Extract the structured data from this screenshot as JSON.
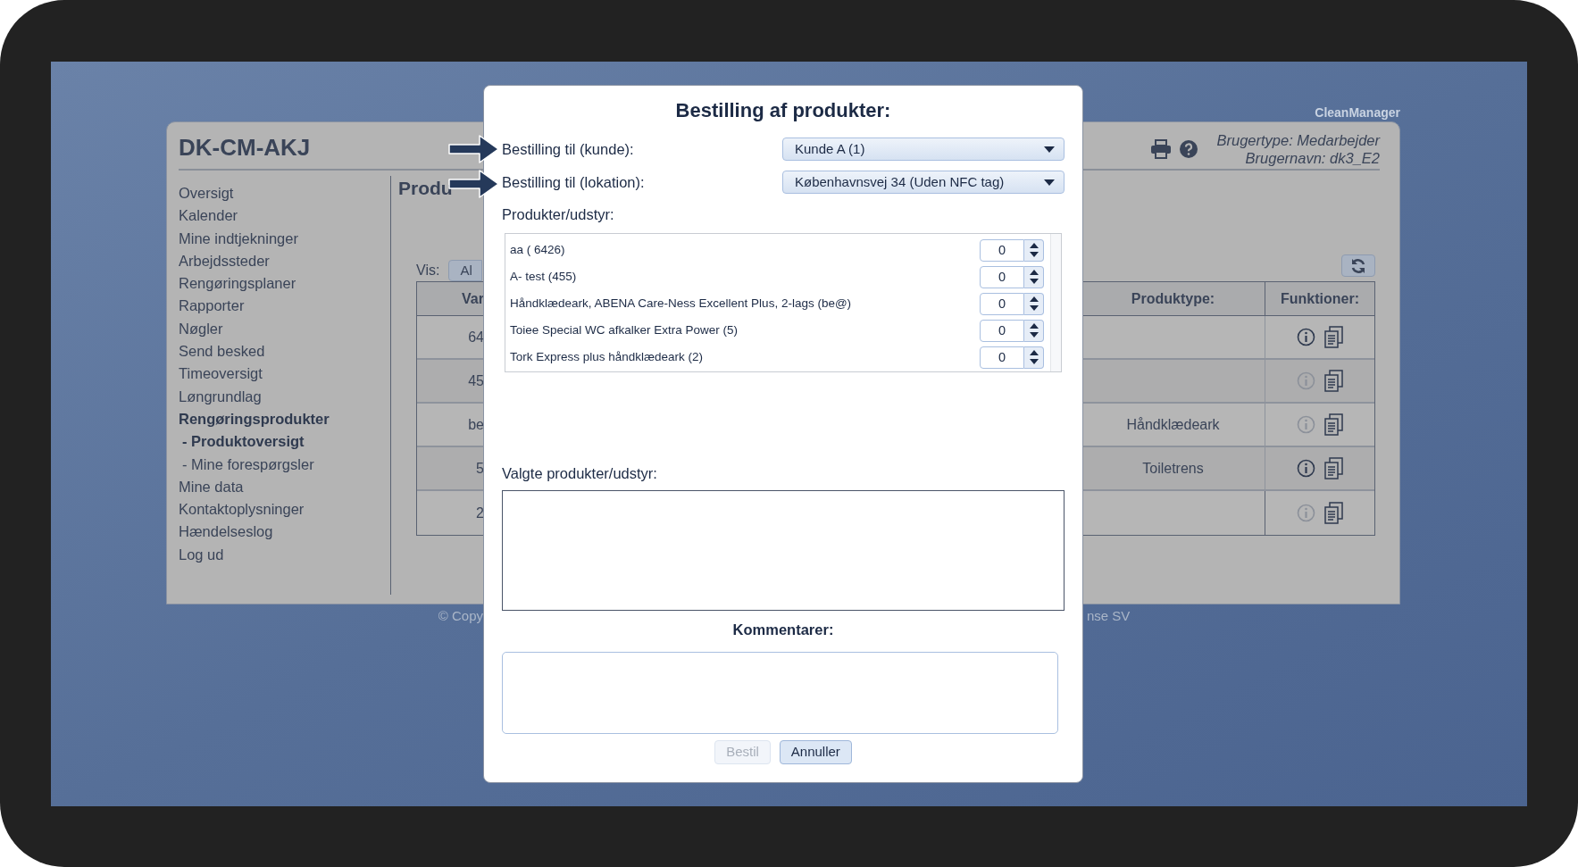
{
  "app": {
    "brand": "CleanManager",
    "site_title": "DK-CM-AKJ",
    "user_type": "Brugertype: Medarbejder",
    "user_name": "Brugernavn: dk3_E2"
  },
  "nav": [
    {
      "label": "Oversigt",
      "selected": false
    },
    {
      "label": "Kalender",
      "selected": false
    },
    {
      "label": "Mine indtjekninger",
      "selected": false
    },
    {
      "label": "Arbejdssteder",
      "selected": false
    },
    {
      "label": "Rengøringsplaner",
      "selected": false
    },
    {
      "label": "Rapporter",
      "selected": false
    },
    {
      "label": "Nøgler",
      "selected": false
    },
    {
      "label": "Send besked",
      "selected": false
    },
    {
      "label": "Timeoversigt",
      "selected": false
    },
    {
      "label": "Løngrundlag",
      "selected": false
    },
    {
      "label": "Rengøringsprodukter",
      "selected": true,
      "children": [
        {
          "label": "- Produktoversigt",
          "selected": true
        },
        {
          "label": "- Mine forespørgsler",
          "selected": false
        }
      ]
    },
    {
      "label": "Mine data",
      "selected": false
    },
    {
      "label": "Kontaktoplysninger",
      "selected": false
    },
    {
      "label": "Hændelseslog",
      "selected": false
    },
    {
      "label": "Log ud",
      "selected": false
    }
  ],
  "content": {
    "heading": "Produ",
    "filter_label": "Vis:",
    "filter_button": "Al"
  },
  "table": {
    "columns": [
      "Var",
      "Produktype:",
      "Funktioner:"
    ],
    "rows": [
      {
        "column_1": "64",
        "info_enabled": true
      },
      {
        "column_1": "45",
        "info_enabled": false
      },
      {
        "column_1": "be",
        "product_type": "Håndklædeark",
        "info_enabled": false
      },
      {
        "column_1": "5",
        "product_type": "Toiletrens",
        "info_enabled": true
      },
      {
        "column_1": "2",
        "info_enabled": false
      }
    ]
  },
  "footer": {
    "left": "© Copy",
    "right": "nse SV"
  },
  "dialog": {
    "title": "Bestilling af produkter:",
    "fields": [
      {
        "label": "Bestilling til (kunde):",
        "value": "Kunde A (1)",
        "pointer_arrow": true
      },
      {
        "label": "Bestilling til (lokation):",
        "value": "Københavnsvej 34 (Uden NFC tag)",
        "pointer_arrow": true
      }
    ],
    "products_label": "Produkter/udstyr:",
    "products": [
      {
        "name": "aa ( 6426)",
        "quantity": "0"
      },
      {
        "name": "A- test (455)",
        "quantity": "0"
      },
      {
        "name": "Håndklædeark, ABENA Care-Ness Excellent Plus, 2-lags (be@)",
        "quantity": "0"
      },
      {
        "name": "Toiee Special WC afkalker Extra Power (5)",
        "quantity": "0"
      },
      {
        "name": "Tork Express plus håndklædeark (2)",
        "quantity": "0"
      }
    ],
    "selected_label": "Valgte produkter/udstyr:",
    "comments_label": "Kommentarer:",
    "buttons": [
      {
        "label": "Bestil",
        "disabled": true
      },
      {
        "label": "Annuller",
        "disabled": false
      }
    ]
  }
}
